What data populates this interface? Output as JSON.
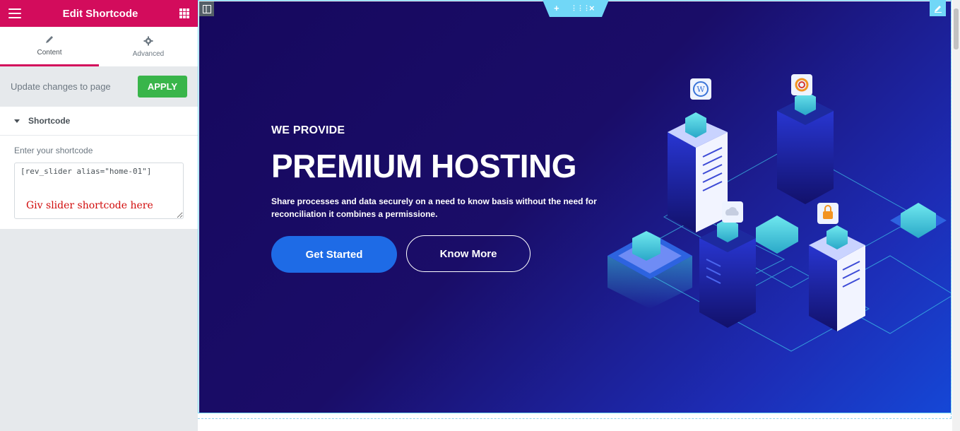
{
  "panel": {
    "title": "Edit Shortcode",
    "tabs": [
      {
        "label": "Content",
        "icon": "pencil-icon"
      },
      {
        "label": "Advanced",
        "icon": "gear-icon"
      }
    ],
    "update_text": "Update changes to page",
    "apply_label": "APPLY",
    "section_title": "Shortcode",
    "field_label": "Enter your shortcode",
    "field_value": "[rev_slider alias=\"home-01\"]",
    "annotation": "Giv slider shortcode here"
  },
  "hero": {
    "eyebrow": "WE PROVIDE",
    "headline": "PREMIUM HOSTING",
    "description": "Share processes and data securely on a need to know basis without the need for reconciliation it combines a permissione.",
    "primary_button": "Get Started",
    "secondary_button": "Know More"
  },
  "colors": {
    "brand": "#d30c5c",
    "apply": "#39b54a",
    "hero_dark": "#16085e",
    "hero_blue": "#1547d6",
    "accent": "#71d7f7",
    "annotation": "#d10a0a"
  }
}
